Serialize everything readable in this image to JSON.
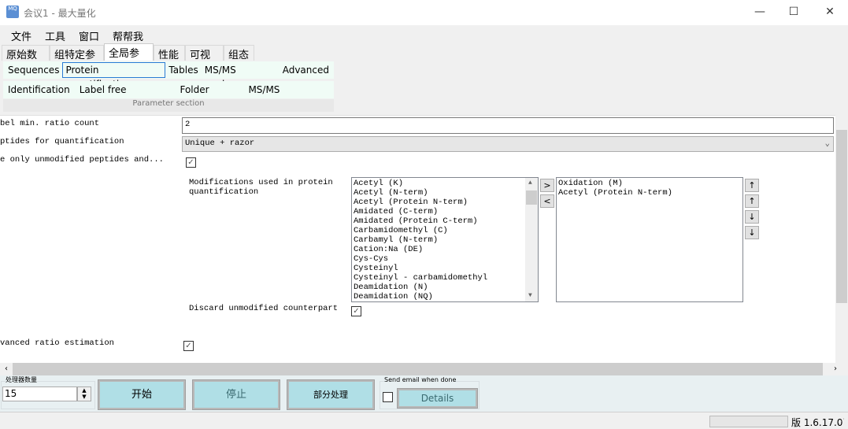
{
  "window": {
    "title": "会议1 - 最大量化",
    "app_icon": "MQ",
    "minimize": "—",
    "maximize": "☐",
    "close": "✕"
  },
  "menu": [
    "文件",
    "工具",
    "窗口",
    "帮帮我"
  ],
  "tabs": [
    {
      "label": "原始数据"
    },
    {
      "label": "组特定参数"
    },
    {
      "label": "全局参数",
      "selected": true
    },
    {
      "label": "性能"
    },
    {
      "label": "可视化"
    },
    {
      "label": "组态"
    }
  ],
  "ribbon": {
    "row1": [
      "Sequences",
      "Protein quantification",
      "Tables",
      "MS/MS analyzer",
      "Advanced"
    ],
    "row2": [
      "Identification",
      "Label free quantification",
      "Folder locations",
      "MS/MS fragmentation"
    ],
    "selected": "Protein quantification",
    "section_label": "Parameter section"
  },
  "params": {
    "min_ratio_label": "bel min. ratio count",
    "min_ratio_value": "2",
    "peptides_label": "ptides for quantification",
    "peptides_value": "Unique + razor",
    "unmod_label": "e only unmodified peptides and...",
    "unmod_checked": true,
    "mods_label": "Modifications used in protein quantification",
    "available_mods": [
      "Acetyl (K)",
      "Acetyl (N-term)",
      "Acetyl (Protein N-term)",
      "Amidated (C-term)",
      "Amidated (Protein C-term)",
      "Carbamidomethyl (C)",
      "Carbamyl (N-term)",
      "Cation:Na (DE)",
      "Cys-Cys",
      "Cysteinyl",
      "Cysteinyl - carbamidomethyl",
      "Deamidation (N)",
      "Deamidation (NQ)"
    ],
    "selected_mods": [
      "Oxidation (M)",
      "Acetyl (Protein N-term)"
    ],
    "add": ">",
    "remove": "<",
    "move_buttons": [
      "↑",
      "↑",
      "↓",
      "↓"
    ],
    "discard_label": "Discard unmodified counterpart",
    "discard_checked": true,
    "advanced_label": "vanced ratio estimation",
    "advanced_checked": true
  },
  "bottom": {
    "threads_label": "处理器数量",
    "threads_value": "15",
    "start": "开始",
    "stop": "停止",
    "partial": "部分处理",
    "email_label": "Send email when done",
    "email_checked": false,
    "details": "Details"
  },
  "status": {
    "version": "版 1.6.17.0"
  }
}
